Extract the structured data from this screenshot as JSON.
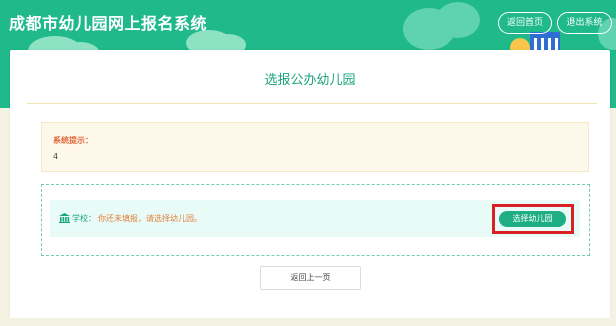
{
  "header": {
    "title": "成都市幼儿园网上报名系统",
    "home_button": "返回首页",
    "logout_button": "退出系统"
  },
  "main": {
    "title": "选报公办幼儿园",
    "notice": {
      "label": "系统提示：",
      "value": "4"
    },
    "selection": {
      "school_icon": "school-building-icon",
      "school_label": "学校：",
      "hint": "你还未填报，请选择幼儿园。",
      "choose_button": "选择幼儿园"
    },
    "back_button": "返回上一页"
  },
  "colors": {
    "header_green": "#1fb98a",
    "accent_green": "#1aa47c",
    "hint_orange": "#e2803d",
    "notice_red": "#e06a3c",
    "highlight_red": "#d92125"
  }
}
